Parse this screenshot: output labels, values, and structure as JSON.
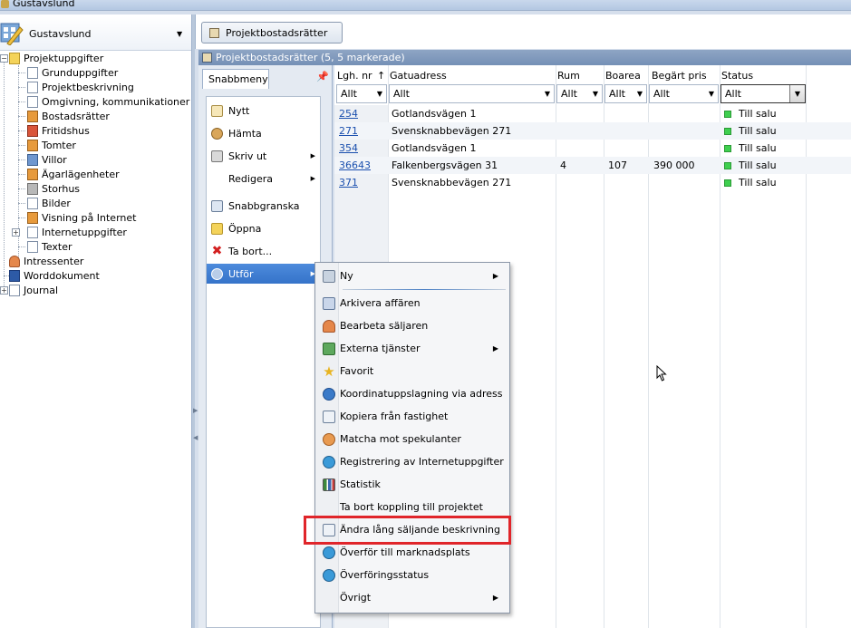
{
  "window": {
    "title": "Gustavslund"
  },
  "selector": {
    "label": "Gustavslund"
  },
  "tree": {
    "items": [
      {
        "label": "Projektuppgifter"
      },
      {
        "label": "Grunduppgifter"
      },
      {
        "label": "Projektbeskrivning"
      },
      {
        "label": "Omgivning, kommunikationer"
      },
      {
        "label": "Bostadsrätter"
      },
      {
        "label": "Fritidshus"
      },
      {
        "label": "Tomter"
      },
      {
        "label": "Villor"
      },
      {
        "label": "Ägarlägenheter"
      },
      {
        "label": "Storhus"
      },
      {
        "label": "Bilder"
      },
      {
        "label": "Visning på Internet"
      },
      {
        "label": "Internetuppgifter"
      },
      {
        "label": "Texter"
      },
      {
        "label": "Intressenter"
      },
      {
        "label": "Worddokument"
      },
      {
        "label": "Journal"
      }
    ]
  },
  "toolbar": {
    "tab_label": "Projektbostadsrätter"
  },
  "grid_header": {
    "title": "Projektbostadsrätter (5, 5 markerade)"
  },
  "snabbmeny": {
    "tab_label": "Snabbmeny",
    "items": [
      {
        "label": "Nytt"
      },
      {
        "label": "Hämta"
      },
      {
        "label": "Skriv ut"
      },
      {
        "label": "Redigera"
      },
      {
        "label": "Snabbgranska"
      },
      {
        "label": "Öppna"
      },
      {
        "label": "Ta bort..."
      },
      {
        "label": "Utför"
      }
    ]
  },
  "grid": {
    "columns": [
      {
        "label": "Lgh. nr",
        "filter": "Allt"
      },
      {
        "label": "Gatuadress",
        "filter": "Allt"
      },
      {
        "label": "Rum",
        "filter": "Allt"
      },
      {
        "label": "Boarea",
        "filter": "Allt"
      },
      {
        "label": "Begärt pris",
        "filter": "Allt"
      },
      {
        "label": "Status",
        "filter": "Allt"
      }
    ],
    "sort_indicator": "↑",
    "rows": [
      {
        "nr": "254",
        "adress": "Gotlandsvägen 1",
        "rum": "",
        "boarea": "",
        "pris": "",
        "status": "Till salu"
      },
      {
        "nr": "271",
        "adress": "Svensknabbevägen 271",
        "rum": "",
        "boarea": "",
        "pris": "",
        "status": "Till salu"
      },
      {
        "nr": "354",
        "adress": "Gotlandsvägen 1",
        "rum": "",
        "boarea": "",
        "pris": "",
        "status": "Till salu"
      },
      {
        "nr": "36643",
        "adress": "Falkenbergsvägen 31",
        "rum": "4",
        "boarea": "107",
        "pris": "390 000",
        "status": "Till salu"
      },
      {
        "nr": "371",
        "adress": "Svensknabbevägen 271",
        "rum": "",
        "boarea": "",
        "pris": "",
        "status": "Till salu"
      }
    ],
    "status_color": "#3fcf4f"
  },
  "context_menu": {
    "items": [
      {
        "label": "Ny"
      },
      {
        "label": "Arkivera affären"
      },
      {
        "label": "Bearbeta säljaren"
      },
      {
        "label": "Externa tjänster"
      },
      {
        "label": "Favorit"
      },
      {
        "label": "Koordinatuppslagning via adress"
      },
      {
        "label": "Kopiera från fastighet"
      },
      {
        "label": "Matcha mot spekulanter"
      },
      {
        "label": "Registrering av Internetuppgifter"
      },
      {
        "label": "Statistik"
      },
      {
        "label": "Ta bort koppling till projektet"
      },
      {
        "label": "Ändra lång säljande beskrivning"
      },
      {
        "label": "Överför till marknadsplats"
      },
      {
        "label": "Överföringsstatus"
      },
      {
        "label": "Övrigt"
      }
    ],
    "highlight_color": "#e0252a"
  }
}
